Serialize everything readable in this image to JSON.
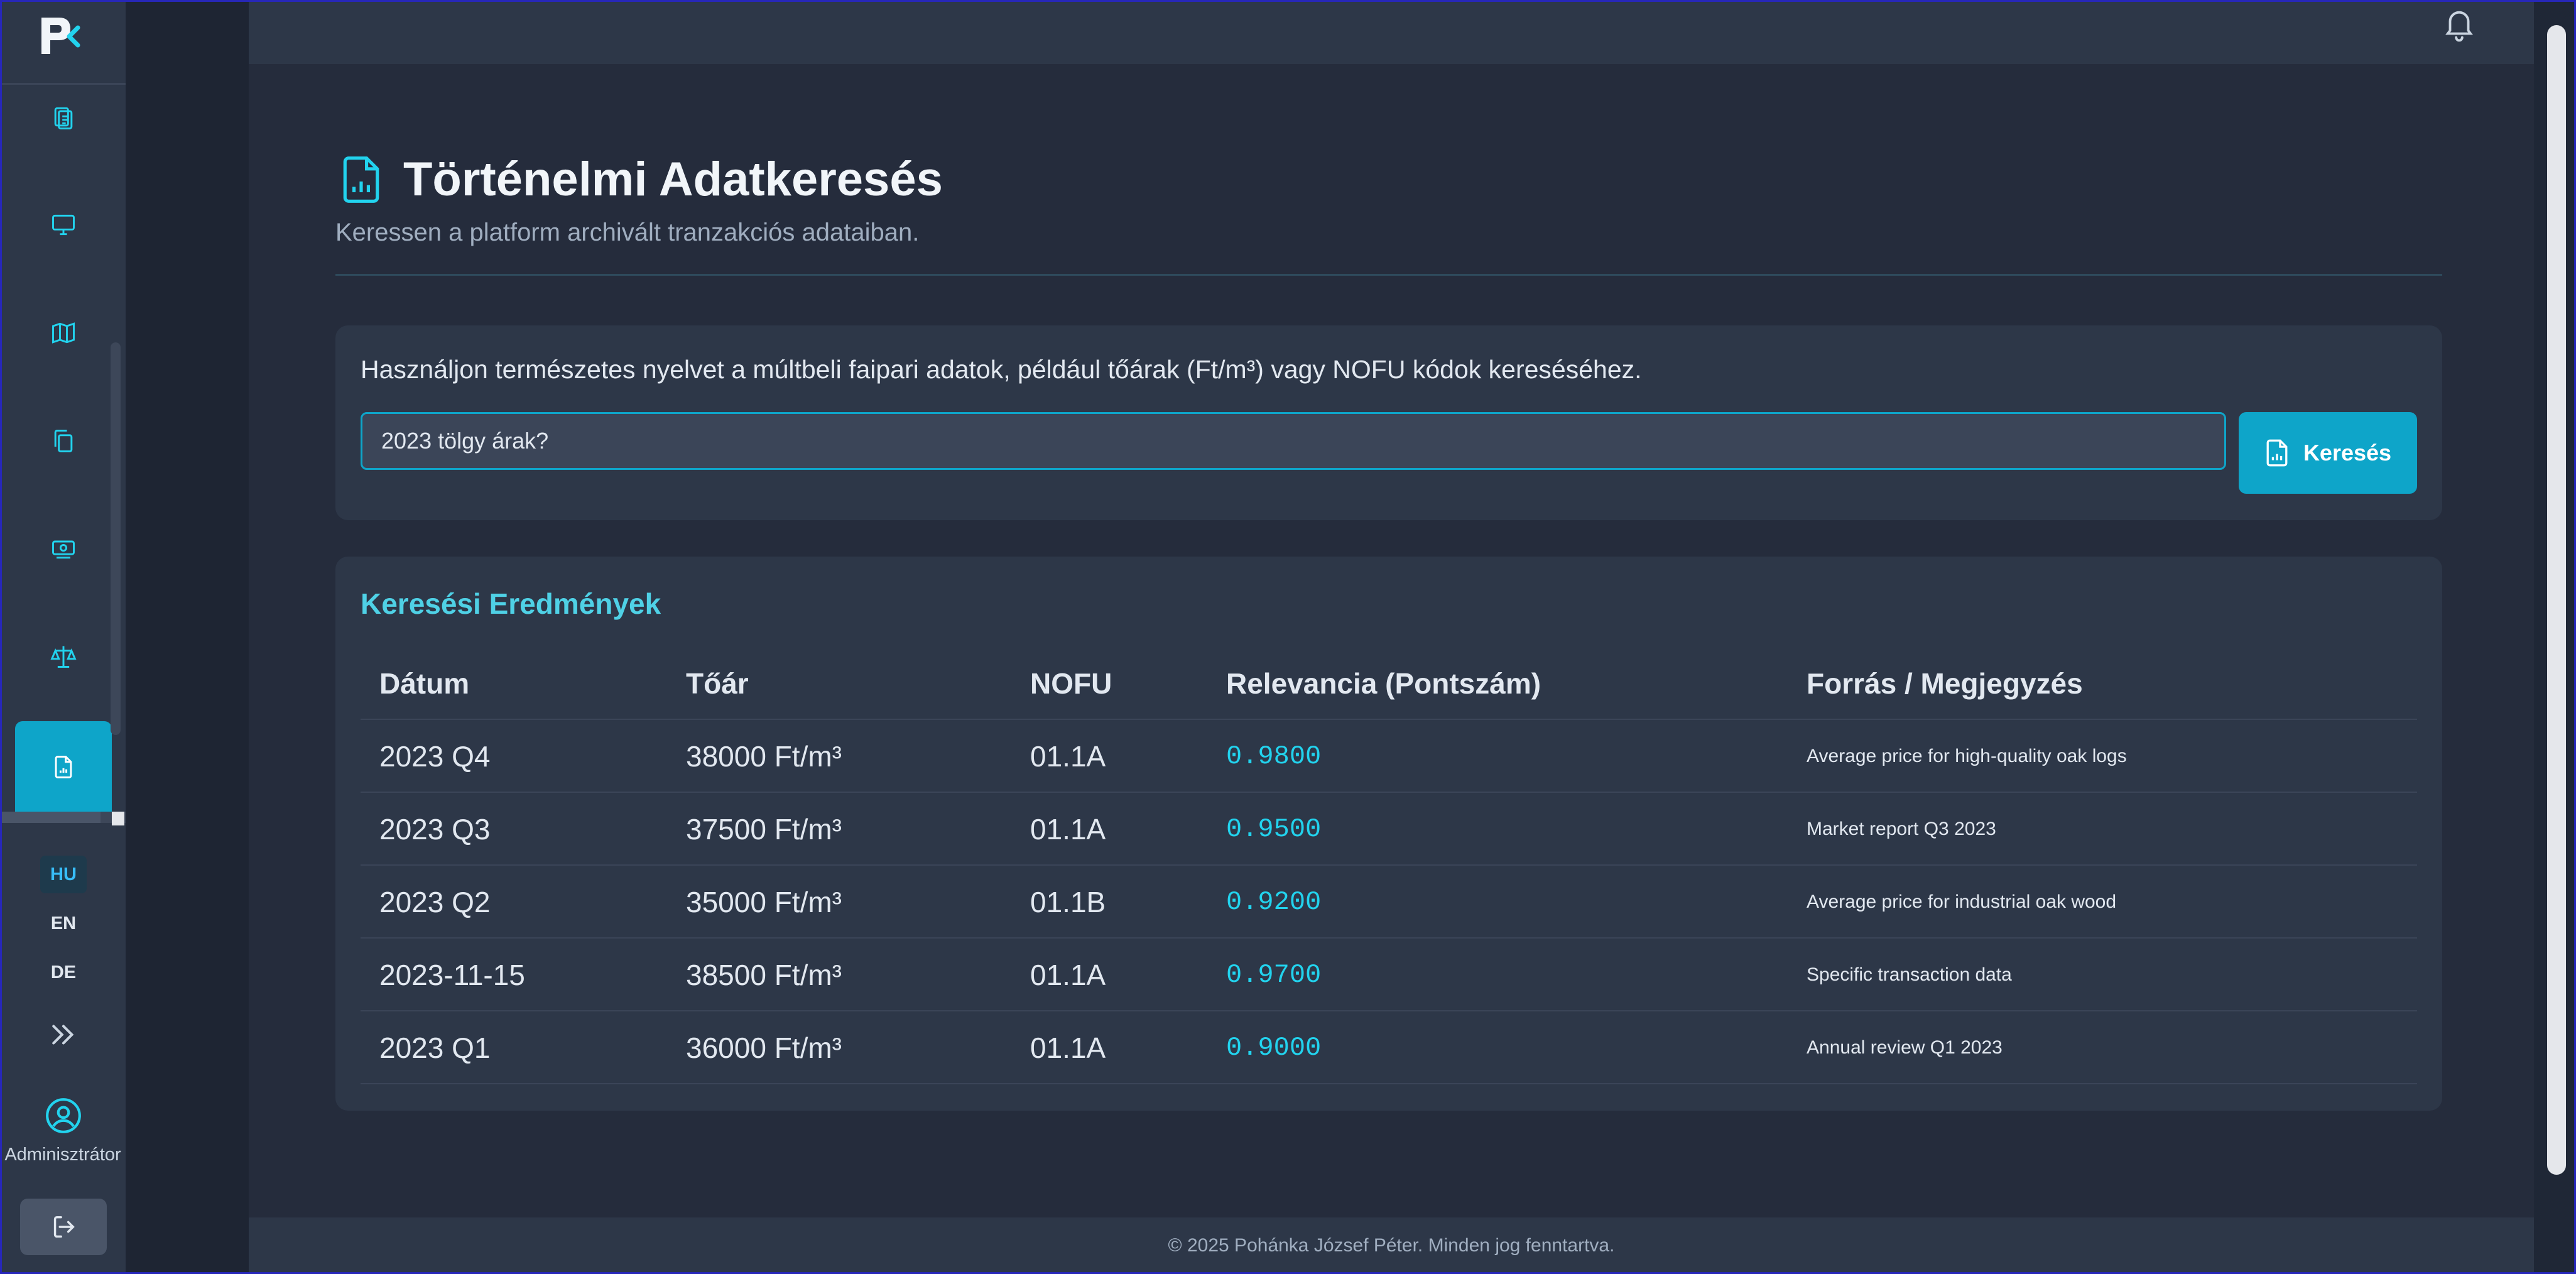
{
  "header": {
    "title": "Történelmi Adatkeresés",
    "subtitle": "Keressen a platform archivált tranzakciós adataiban."
  },
  "search": {
    "hint": "Használjon természetes nyelvet a múltbeli faipari adatok, például tőárak (Ft/m³) vagy NOFU kódok kereséséhez.",
    "value": "2023 tölgy árak?",
    "button_label": "Keresés"
  },
  "results": {
    "title": "Keresési Eredmények",
    "columns": [
      "Dátum",
      "Tőár",
      "NOFU",
      "Relevancia (Pontszám)",
      "Forrás / Megjegyzés"
    ],
    "rows": [
      {
        "date": "2023 Q4",
        "price": "38000 Ft/m³",
        "nofu": "01.1A",
        "score": "0.9800",
        "note": "Average price for high-quality oak logs"
      },
      {
        "date": "2023 Q3",
        "price": "37500 Ft/m³",
        "nofu": "01.1A",
        "score": "0.9500",
        "note": "Market report Q3 2023"
      },
      {
        "date": "2023 Q2",
        "price": "35000 Ft/m³",
        "nofu": "01.1B",
        "score": "0.9200",
        "note": "Average price for industrial oak wood"
      },
      {
        "date": "2023-11-15",
        "price": "38500 Ft/m³",
        "nofu": "01.1A",
        "score": "0.9700",
        "note": "Specific transaction data"
      },
      {
        "date": "2023 Q1",
        "price": "36000 Ft/m³",
        "nofu": "01.1A",
        "score": "0.9000",
        "note": "Annual review Q1 2023"
      }
    ]
  },
  "sidebar": {
    "languages": [
      "HU",
      "EN",
      "DE"
    ],
    "active_language": "HU",
    "user_label": "Adminisztrátor",
    "nav_icons": [
      "clipboard-icon",
      "monitor-icon",
      "map-icon",
      "copy-icon",
      "money-icon",
      "scale-icon",
      "report-icon"
    ]
  },
  "footer": {
    "text": "© 2025 Pohánka József Péter. Minden jog fenntartva."
  },
  "colors": {
    "accent": "#0ea5c9",
    "score": "#22d3ee",
    "results_title": "#4fd1e6",
    "panel": "#2d3748",
    "background": "#252c3c"
  }
}
